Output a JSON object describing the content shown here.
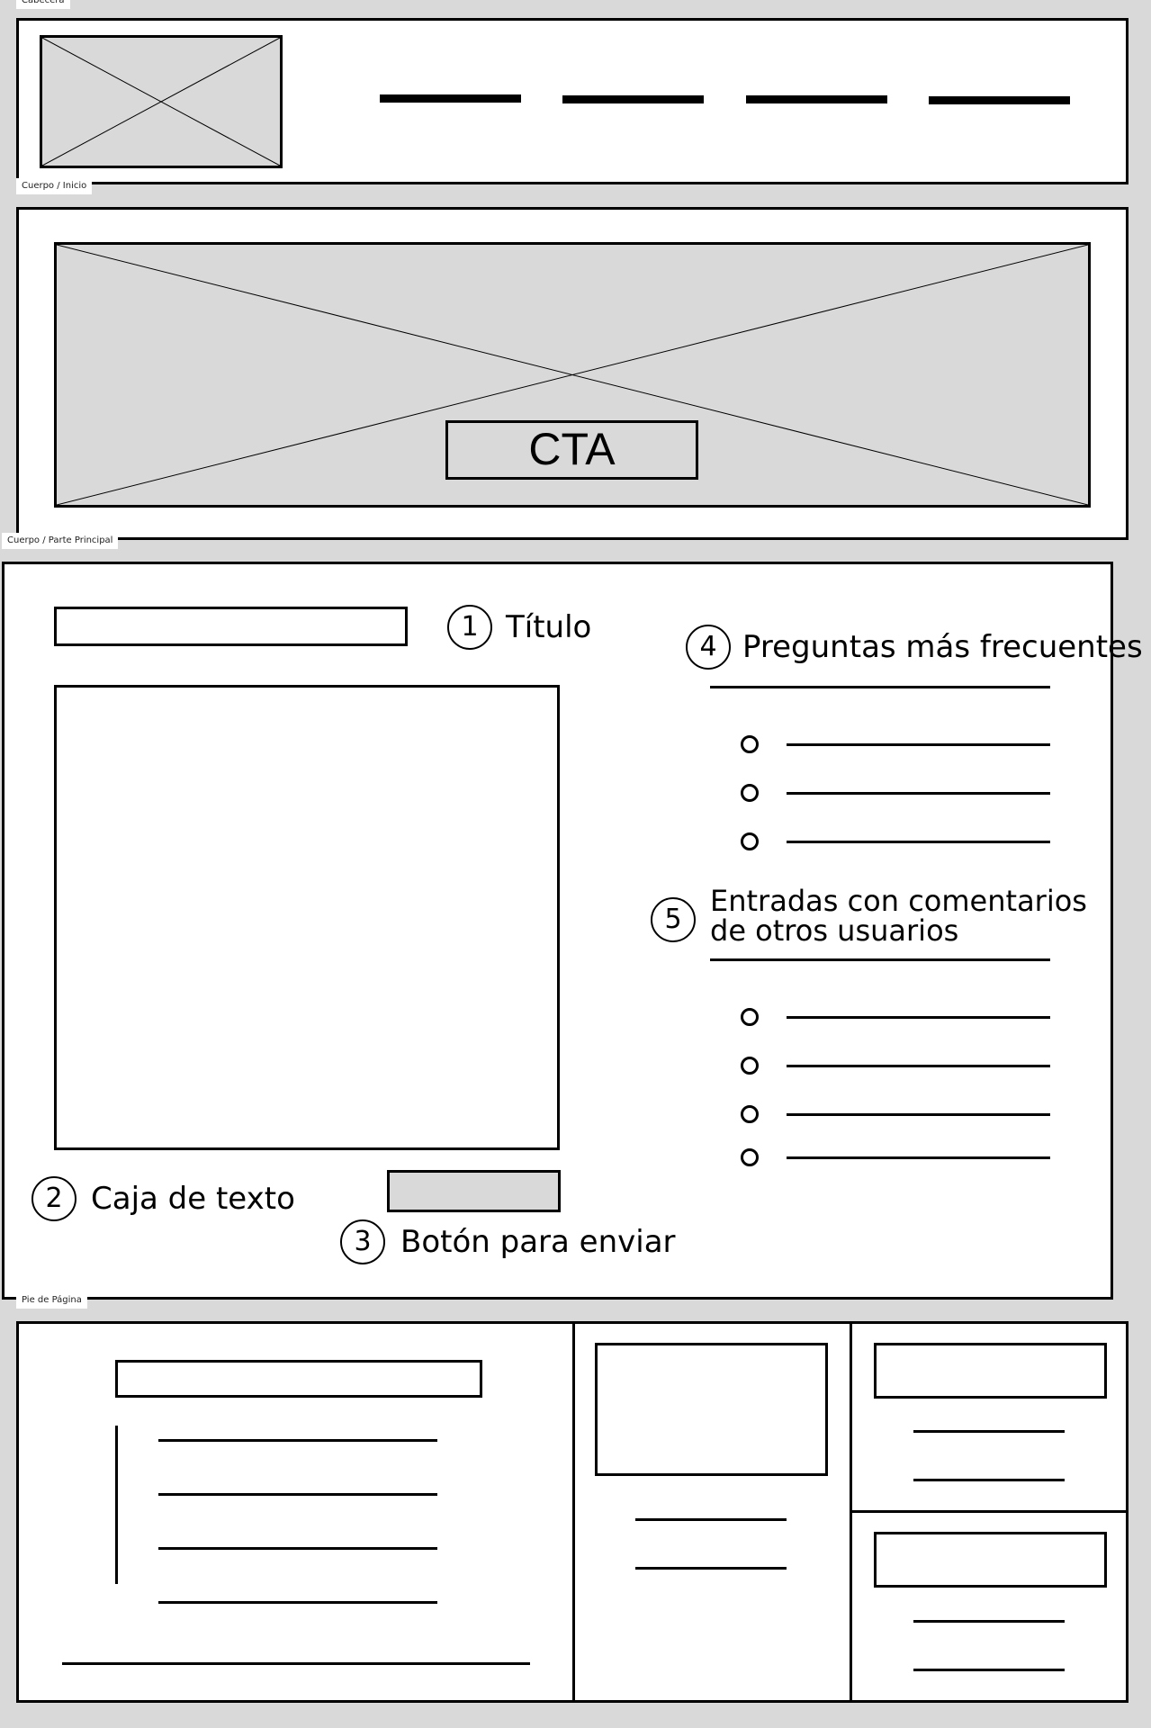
{
  "frames": {
    "header": {
      "label": "Cabecera"
    },
    "hero": {
      "label": "Cuerpo / Inicio"
    },
    "main": {
      "label": "Cuerpo / Parte Principal"
    },
    "footer": {
      "label": "Pie de Página"
    }
  },
  "hero": {
    "cta_label": "CTA"
  },
  "annotations": {
    "title": {
      "number": "1",
      "text": "Título"
    },
    "textbox": {
      "number": "2",
      "text": "Caja de texto"
    },
    "submit": {
      "number": "3",
      "text": "Botón para enviar"
    },
    "faq": {
      "number": "4",
      "text": "Preguntas más frecuentes"
    },
    "comments": {
      "number": "5",
      "line1": "Entradas con comentarios",
      "line2": "de otros usuarios"
    }
  },
  "colors": {
    "background": "#d9d9d9",
    "frame": "#ffffff",
    "stroke": "#000000",
    "placeholder": "#d9d9d9"
  }
}
